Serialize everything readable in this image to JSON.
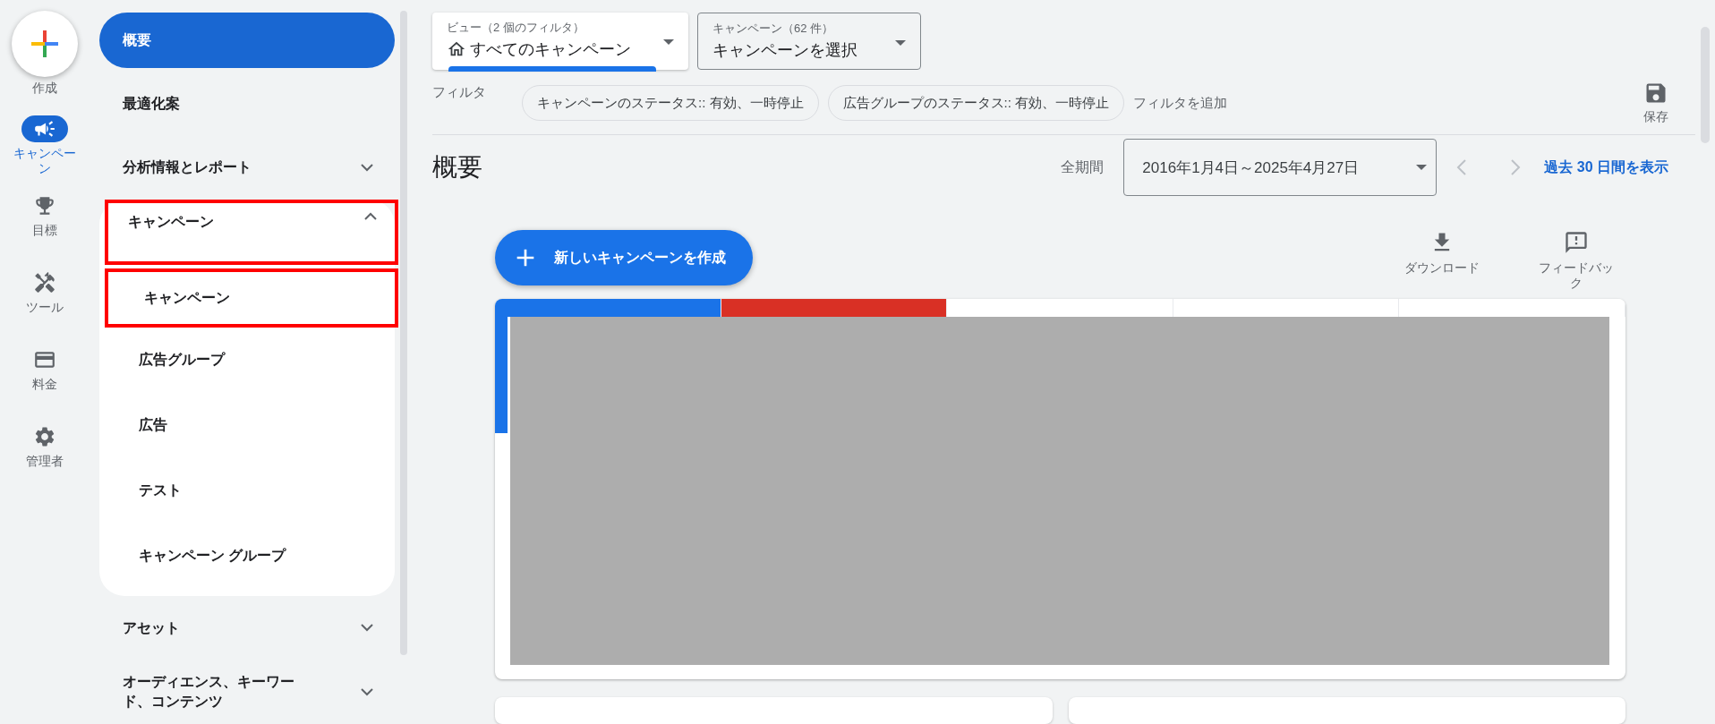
{
  "rail": {
    "create": {
      "label": "作成"
    },
    "items": [
      {
        "label": "キャンペーン",
        "kind": "megaphone",
        "selected": true
      },
      {
        "label": "目標",
        "kind": "trophy",
        "selected": false
      },
      {
        "label": "ツール",
        "kind": "tools",
        "selected": false
      },
      {
        "label": "料金",
        "kind": "card",
        "selected": false
      },
      {
        "label": "管理者",
        "kind": "gear",
        "selected": false
      }
    ]
  },
  "nav": {
    "items": [
      {
        "label": "概要",
        "kind": "link",
        "selected": true
      },
      {
        "label": "最適化案",
        "kind": "link",
        "selected": false
      },
      {
        "label": "分析情報とレポート",
        "kind": "section",
        "selected": false,
        "expanded": false
      },
      {
        "label": "キャンペーン",
        "kind": "section",
        "selected": false,
        "expanded": true,
        "highlighted": true,
        "children": [
          {
            "label": "キャンペーン",
            "selected": false,
            "highlighted": true
          },
          {
            "label": "広告グループ",
            "selected": false,
            "highlighted": false
          },
          {
            "label": "広告",
            "selected": false,
            "highlighted": false
          },
          {
            "label": "テスト",
            "selected": false,
            "highlighted": false
          },
          {
            "label": "キャンペーン グループ",
            "selected": false,
            "highlighted": false
          }
        ]
      },
      {
        "label": "アセット",
        "kind": "section",
        "selected": false,
        "expanded": false
      },
      {
        "label": "オーディエンス、キーワード、コンテンツ",
        "kind": "section",
        "selected": false,
        "expanded": false
      }
    ]
  },
  "view_selector": {
    "label": "ビュー（2 個のフィルタ）",
    "value": "すべてのキャンペーン"
  },
  "campaign_selector": {
    "label": "キャンペーン（62 件）",
    "value": "キャンペーンを選択"
  },
  "filters": {
    "label": "フィルタ",
    "chips": [
      "キャンペーンのステータス:: 有効、一時停止",
      "広告グループのステータス:: 有効、一時停止"
    ],
    "add": "フィルタを追加",
    "save": "保存"
  },
  "page_title": "概要",
  "date_range": {
    "label": "全期間",
    "value": "2016年1月4日～2025年4月27日",
    "link": "過去 30 日間を表示"
  },
  "new_campaign": "新しいキャンペーンを作成",
  "tools": [
    {
      "label": "ダウンロード",
      "kind": "download"
    },
    {
      "label": "フィードバック",
      "kind": "feedback"
    }
  ],
  "metric_tabs": [
    {
      "selected": true,
      "color": "#1a73e8"
    },
    {
      "selected": true,
      "color": "#d93025"
    },
    {
      "selected": false
    },
    {
      "selected": false
    },
    {
      "selected": false
    }
  ]
}
